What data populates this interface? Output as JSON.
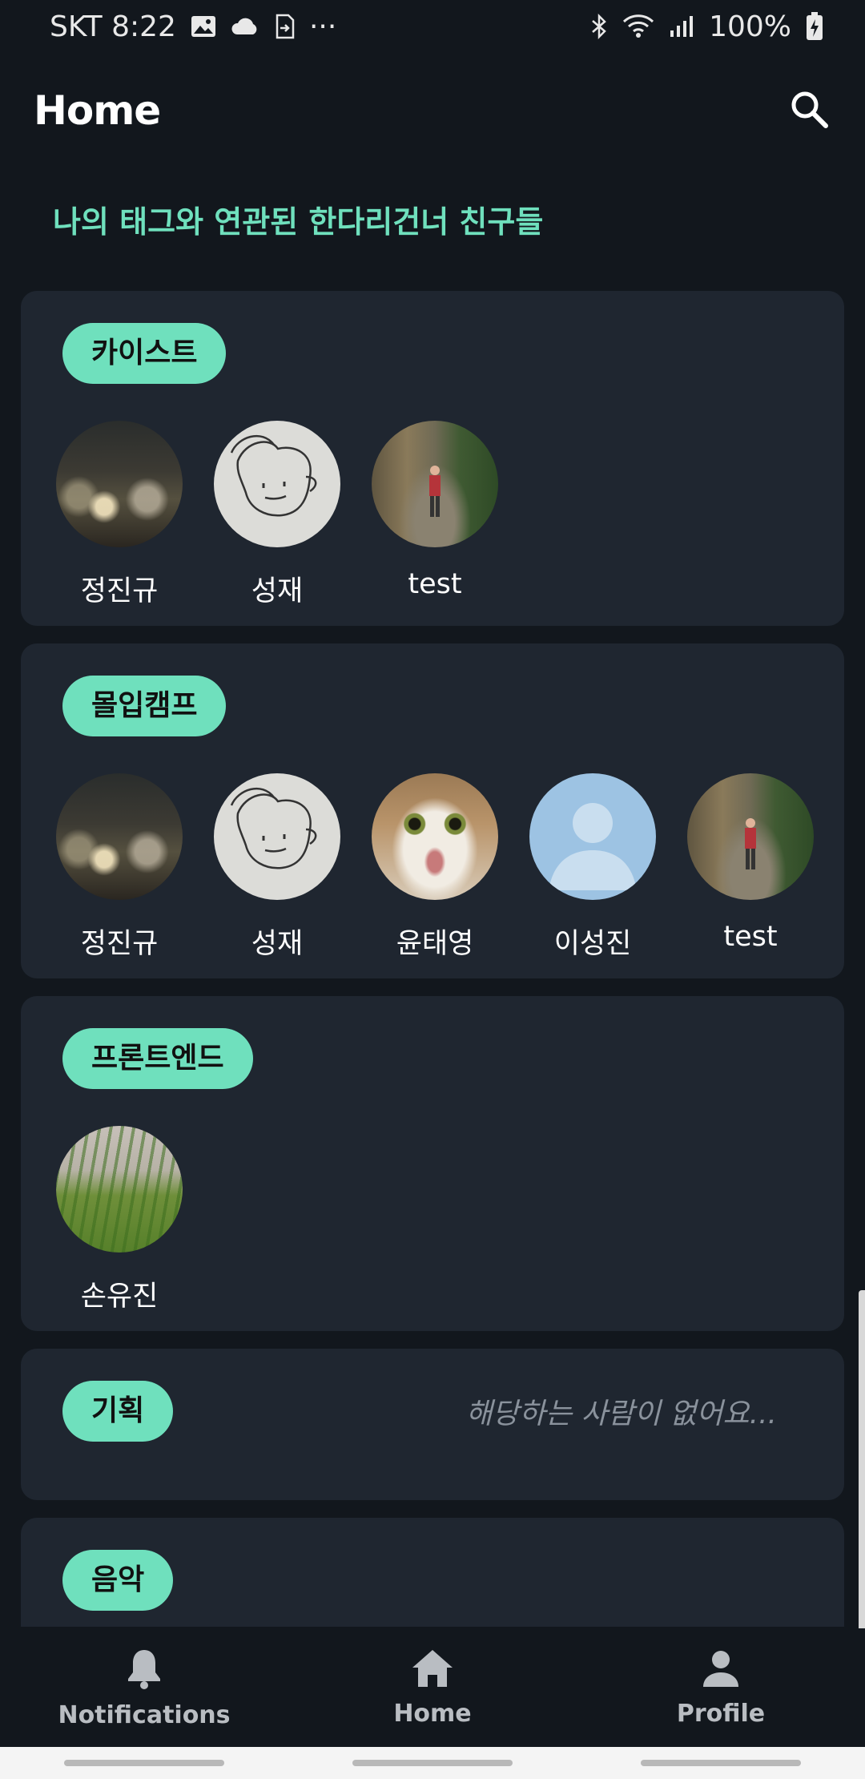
{
  "status_bar": {
    "carrier_time": "SKT 8:22",
    "more": "···",
    "battery": "100%",
    "icons": [
      "image-icon",
      "cloud-icon",
      "sim-icon",
      "bluetooth-icon",
      "wifi-icon",
      "signal-icon",
      "battery-charging-icon"
    ]
  },
  "app_bar": {
    "title": "Home",
    "search_icon": "search-icon"
  },
  "section_heading": "나의 태그와 연관된 한다리건너 친구들",
  "cards": [
    {
      "tag": "카이스트",
      "friends": [
        {
          "name": "정진규",
          "avatar": "photo-drinks"
        },
        {
          "name": "성재",
          "avatar": "photo-drawing"
        },
        {
          "name": "test",
          "avatar": "photo-forest"
        }
      ]
    },
    {
      "tag": "몰입캠프",
      "friends": [
        {
          "name": "정진규",
          "avatar": "photo-drinks"
        },
        {
          "name": "성재",
          "avatar": "photo-drawing"
        },
        {
          "name": "윤태영",
          "avatar": "photo-cat"
        },
        {
          "name": "이성진",
          "avatar": "default-avatar"
        },
        {
          "name": "test",
          "avatar": "photo-forest"
        }
      ]
    },
    {
      "tag": "프론트엔드",
      "friends": [
        {
          "name": "손유진",
          "avatar": "photo-grass"
        }
      ]
    },
    {
      "tag": "기획",
      "empty_message": "해당하는 사람이 없어요..."
    },
    {
      "tag": "음악"
    }
  ],
  "bottom_nav": [
    {
      "label": "Notifications",
      "icon": "bell-icon"
    },
    {
      "label": "Home",
      "icon": "home-icon"
    },
    {
      "label": "Profile",
      "icon": "person-icon"
    }
  ],
  "colors": {
    "background": "#12171d",
    "card": "#1f2630",
    "accent": "#6fe0bd",
    "muted_text": "#8a929c"
  }
}
